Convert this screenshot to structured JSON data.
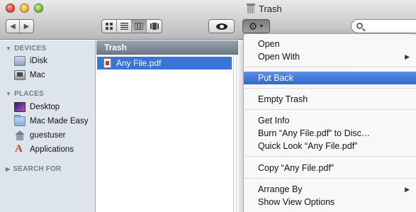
{
  "window": {
    "title": "Trash"
  },
  "search": {
    "placeholder": ""
  },
  "sidebar": {
    "sections": [
      {
        "label": "DEVICES",
        "items": [
          {
            "label": "iDisk"
          },
          {
            "label": "Mac"
          }
        ]
      },
      {
        "label": "PLACES",
        "items": [
          {
            "label": "Desktop"
          },
          {
            "label": "Mac Made Easy"
          },
          {
            "label": "guestuser"
          },
          {
            "label": "Applications"
          }
        ]
      },
      {
        "label": "SEARCH FOR",
        "items": []
      }
    ]
  },
  "main": {
    "column_header": "Trash",
    "files": [
      {
        "name": "Any File.pdf",
        "selected": true
      }
    ]
  },
  "context_menu": {
    "groups": [
      [
        {
          "label": "Open"
        },
        {
          "label": "Open With",
          "submenu": true
        }
      ],
      [
        {
          "label": "Put Back",
          "highlighted": true
        }
      ],
      [
        {
          "label": "Empty Trash"
        }
      ],
      [
        {
          "label": "Get Info"
        },
        {
          "label": "Burn “Any File.pdf” to Disc…"
        },
        {
          "label": "Quick Look “Any File.pdf”"
        }
      ],
      [
        {
          "label": "Copy “Any File.pdf”"
        }
      ],
      [
        {
          "label": "Arrange By",
          "submenu": true
        },
        {
          "label": "Show View Options"
        }
      ]
    ]
  },
  "colors": {
    "selection": "#3875d7",
    "sidebar_bg": "#dde4ec",
    "menu_highlight": "#3f79dc"
  }
}
